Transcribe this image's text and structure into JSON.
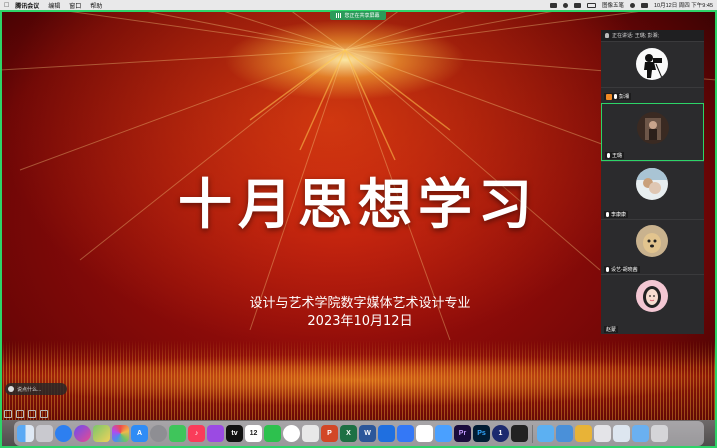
{
  "menubar": {
    "app_name": "腾讯会议",
    "menu": [
      "编辑",
      "窗口",
      "帮助"
    ],
    "status_text": "图像五笔",
    "clock": "10月12日 周四 下午9:45"
  },
  "share_tag": "您正在共享屏幕",
  "slide": {
    "title": "十月思想学习",
    "subtitle": "设计与艺术学院数字媒体艺术设计专业",
    "date": "2023年10月12日"
  },
  "panel": {
    "header": "正在讲话: 王璐; 彭湘;",
    "participants": [
      {
        "name": "",
        "avatar": "photographer-silhouette-avatar",
        "active": false
      },
      {
        "name": "彭湘",
        "avatar": "person-avatar",
        "active": true,
        "host": true
      },
      {
        "name": "王璐",
        "avatar": "photo-avatar",
        "active": false
      },
      {
        "name": "李康康",
        "avatar": "dog-avatar",
        "active": false
      },
      {
        "name": "设艺-胡晓茜",
        "avatar": "cartoon-girl-avatar",
        "active": false
      }
    ],
    "last_label": "赵蒙"
  },
  "notice": "说点什么...",
  "colors": {
    "share_border": "#2dd468",
    "host_badge": "#f08a24",
    "slide_red": "#b3120d"
  },
  "dock": {
    "icons": [
      "finder",
      "launchpad",
      "safari",
      "siri",
      "maps",
      "photos",
      "app-store",
      "settings",
      "facetime",
      "music",
      "podcasts",
      "tv",
      "calendar",
      "wechat",
      "tencent-meeting",
      "qq",
      "powerpoint",
      "excel",
      "word",
      "xcode",
      "feishu",
      "notes",
      "baidu-netdisk",
      "premiere",
      "photoshop",
      "one",
      "capcut",
      "folder",
      "preview",
      "keynote",
      "downloads",
      "trash"
    ],
    "calendar_day": "12"
  }
}
